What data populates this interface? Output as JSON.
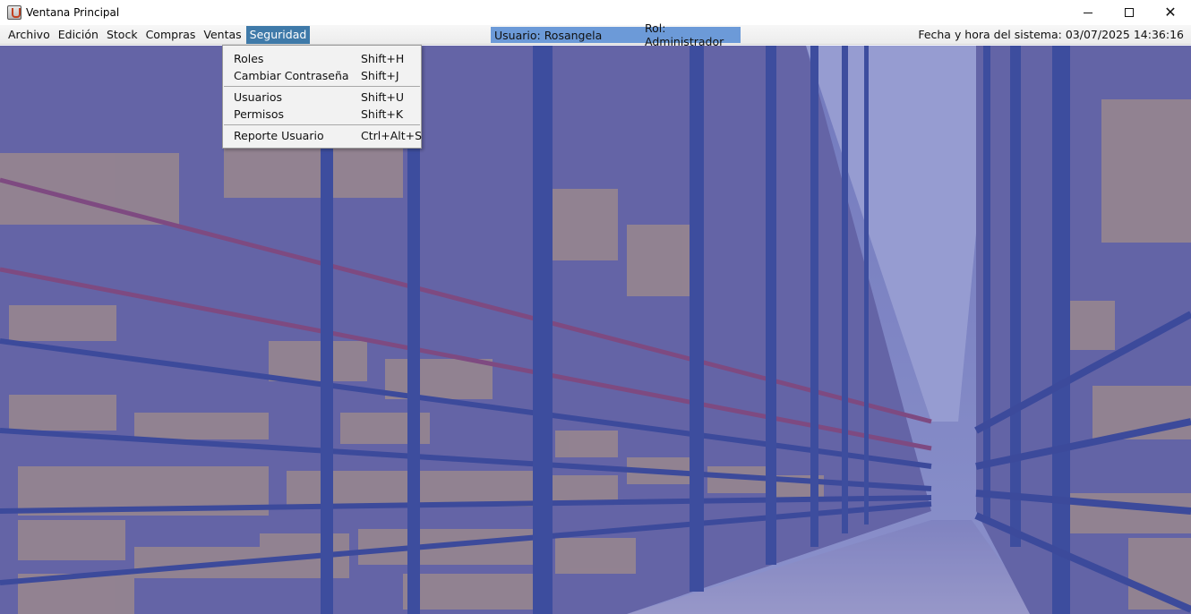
{
  "window": {
    "title": "Ventana Principal",
    "minimize_glyph": "",
    "maximize_glyph": "",
    "close_glyph": "✕"
  },
  "menubar": {
    "items": [
      {
        "label": "Archivo"
      },
      {
        "label": "Edición"
      },
      {
        "label": "Stock"
      },
      {
        "label": "Compras"
      },
      {
        "label": "Ventas"
      },
      {
        "label": "Seguridad",
        "active": true
      }
    ],
    "user": "Usuario: Rosangela",
    "role": "Rol: Administrador",
    "system_datetime": "Fecha y hora del sistema: 03/07/2025 14:36:16"
  },
  "seguridad_menu": {
    "items": [
      {
        "label": "Roles",
        "accelerator": "Shift+H"
      },
      {
        "label": "Cambiar Contraseña",
        "accelerator": "Shift+J"
      },
      {
        "label": "Usuarios",
        "accelerator": "Shift+U"
      },
      {
        "label": "Permisos",
        "accelerator": "Shift+K"
      },
      {
        "label": "Reporte Usuario",
        "accelerator": "Ctrl+Alt+S"
      }
    ]
  },
  "colors": {
    "menu_active": "#3f7aa9",
    "userbar_bg": "#6c9ad8",
    "scene_tint": "#4a4fa0"
  },
  "icons": [
    "app-java-icon",
    "minimize-icon",
    "maximize-icon",
    "close-icon"
  ]
}
